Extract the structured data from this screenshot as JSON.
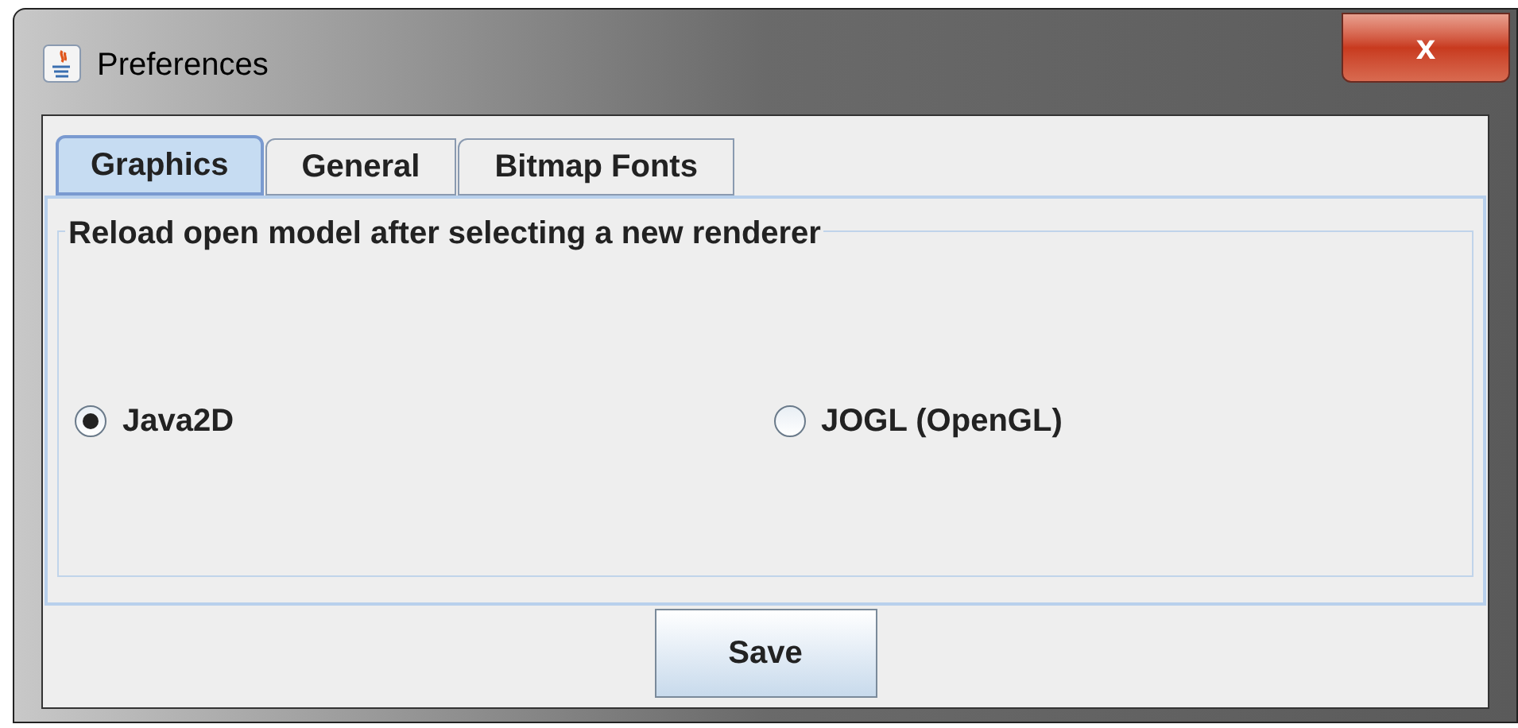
{
  "window": {
    "title": "Preferences",
    "close": "x"
  },
  "tabs": [
    {
      "label": "Graphics",
      "selected": true
    },
    {
      "label": "General",
      "selected": false
    },
    {
      "label": "Bitmap Fonts",
      "selected": false
    }
  ],
  "group": {
    "title": "Reload open model after selecting a new renderer"
  },
  "radios": [
    {
      "label": "Java2D",
      "selected": true
    },
    {
      "label": "JOGL (OpenGL)",
      "selected": false
    }
  ],
  "buttons": [
    "Save"
  ]
}
